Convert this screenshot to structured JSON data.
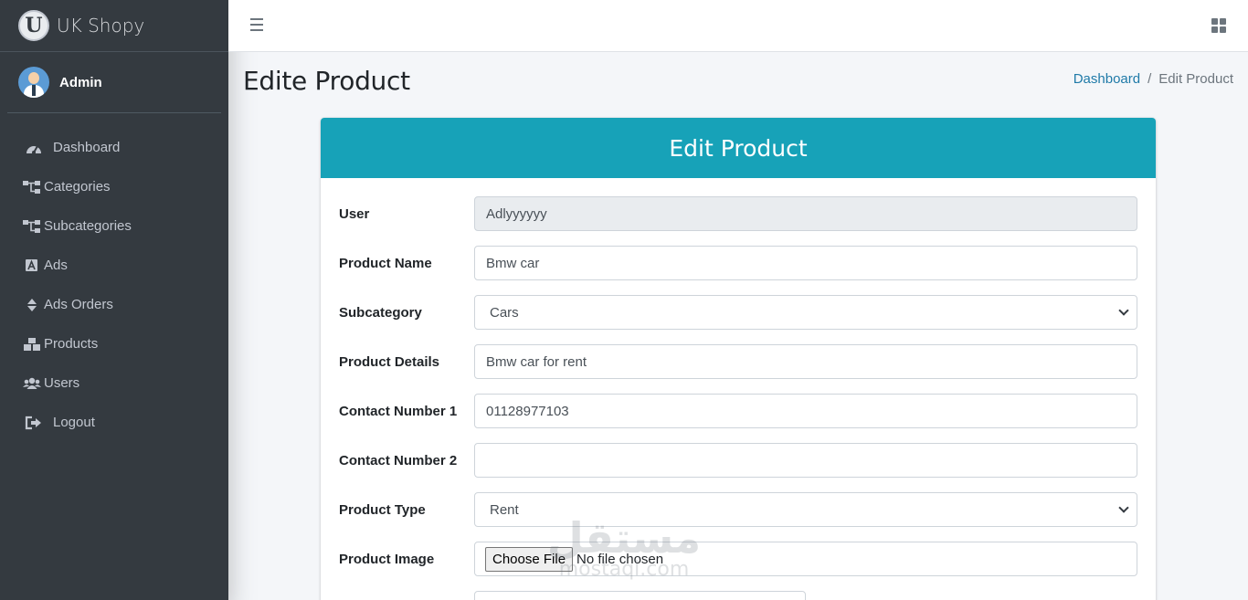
{
  "brand": {
    "logo_letter": "U",
    "name": "UK Shopy"
  },
  "user": {
    "name": "Admin"
  },
  "sidebar": {
    "items": [
      {
        "label": "Dashboard",
        "icon": "tachometer-icon",
        "glyph": "◔"
      },
      {
        "label": "Categories",
        "icon": "sitemap-icon",
        "glyph": "⊶"
      },
      {
        "label": "Subcategories",
        "icon": "sitemap-icon",
        "glyph": "⊶"
      },
      {
        "label": "Ads",
        "icon": "ad-icon",
        "glyph": "A"
      },
      {
        "label": "Ads Orders",
        "icon": "sort-icon",
        "glyph": "⬍"
      },
      {
        "label": "Products",
        "icon": "boxes-icon",
        "glyph": "▞"
      },
      {
        "label": "Users",
        "icon": "users-icon",
        "glyph": "👥"
      },
      {
        "label": "Logout",
        "icon": "sign-out-icon",
        "glyph": "⇥"
      }
    ]
  },
  "page": {
    "title": "Edite Product"
  },
  "breadcrumb": {
    "home": "Dashboard",
    "separator": "/",
    "current": "Edit Product"
  },
  "card": {
    "title": "Edit Product"
  },
  "form": {
    "user": {
      "label": "User",
      "value": "Adlyyyyyy"
    },
    "product_name": {
      "label": "Product Name",
      "value": "Bmw car"
    },
    "subcategory": {
      "label": "Subcategory",
      "value": "Cars"
    },
    "product_details": {
      "label": "Product Details",
      "value": "Bmw car for rent"
    },
    "contact_1": {
      "label": "Contact Number 1",
      "value": "01128977103"
    },
    "contact_2": {
      "label": "Contact Number 2",
      "value": ""
    },
    "product_type": {
      "label": "Product Type",
      "value": "Rent"
    },
    "product_image": {
      "label": "Product Image",
      "button": "Choose File",
      "status": "No file chosen"
    }
  },
  "watermark": {
    "arabic": "مستقل",
    "latin": "mostaql.com"
  },
  "colors": {
    "sidebar": "#343a40",
    "accent": "#17a2b8",
    "link": "#1f7aa8",
    "background": "#f4f6f9"
  }
}
